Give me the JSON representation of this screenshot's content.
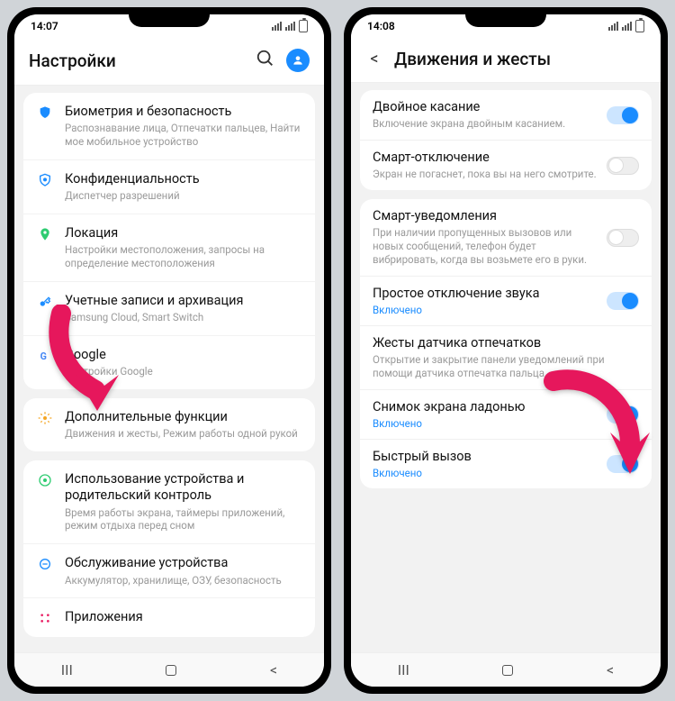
{
  "left": {
    "time": "14:07",
    "title": "Настройки",
    "items": [
      {
        "icon": "shield-fingerprint",
        "color": "#1a8cff",
        "title": "Биометрия и безопасность",
        "sub": "Распознавание лица, Отпечатки пальцев, Найти мое мобильное устройство"
      },
      {
        "icon": "shield-lock",
        "color": "#1a8cff",
        "title": "Конфиденциальность",
        "sub": "Диспетчер разрешений"
      },
      {
        "icon": "pin",
        "color": "#2ecc71",
        "title": "Локация",
        "sub": "Настройки местоположения, запросы на определение местоположения"
      },
      {
        "icon": "key",
        "color": "#1a8cff",
        "title": "Учетные записи и архивация",
        "sub": "Samsung Cloud, Smart Switch"
      },
      {
        "icon": "google",
        "color": "#4285F4",
        "title": "Google",
        "sub": "Настройки Google"
      },
      {
        "icon": "gear",
        "color": "#f5a623",
        "title": "Дополнительные функции",
        "sub": "Движения и жесты, Режим работы одной рукой"
      },
      {
        "icon": "wellbeing",
        "color": "#2ecc71",
        "title": "Использование устройства и родительский контроль",
        "sub": "Время работы экрана, таймеры приложений, режим отдыха перед сном"
      },
      {
        "icon": "care",
        "color": "#1a8cff",
        "title": "Обслуживание устройства",
        "sub": "Аккумулятор, хранилище, ОЗУ, безопасность"
      },
      {
        "icon": "apps",
        "color": "#e91e63",
        "title": "Приложения",
        "sub": ""
      }
    ]
  },
  "right": {
    "time": "14:08",
    "title": "Движения и жесты",
    "groups": [
      [
        {
          "title": "Двойное касание",
          "sub": "Включение экрана двойным касанием.",
          "status": "",
          "toggle": "on"
        },
        {
          "title": "Смарт-отключение",
          "sub": "Экран не погаснет, пока вы на него смотрите.",
          "status": "",
          "toggle": "off"
        }
      ],
      [
        {
          "title": "Смарт-уведомления",
          "sub": "При наличии пропущенных вызовов или новых сообщений, телефон будет вибрировать, когда вы возьмете его в руки.",
          "status": "",
          "toggle": "off"
        },
        {
          "title": "Простое отключение звука",
          "sub": "",
          "status": "Включено",
          "toggle": "on"
        },
        {
          "title": "Жесты датчика отпечатков",
          "sub": "Открытие и закрытие панели уведомлений при помощи датчика отпечатка пальца.",
          "status": "",
          "toggle": ""
        },
        {
          "title": "Снимок экрана ладонью",
          "sub": "",
          "status": "Включено",
          "toggle": "on"
        },
        {
          "title": "Быстрый вызов",
          "sub": "",
          "status": "Включено",
          "toggle": "on"
        }
      ]
    ]
  },
  "nav": {
    "recents": "III",
    "back": "<"
  },
  "accent": "#e6175c"
}
